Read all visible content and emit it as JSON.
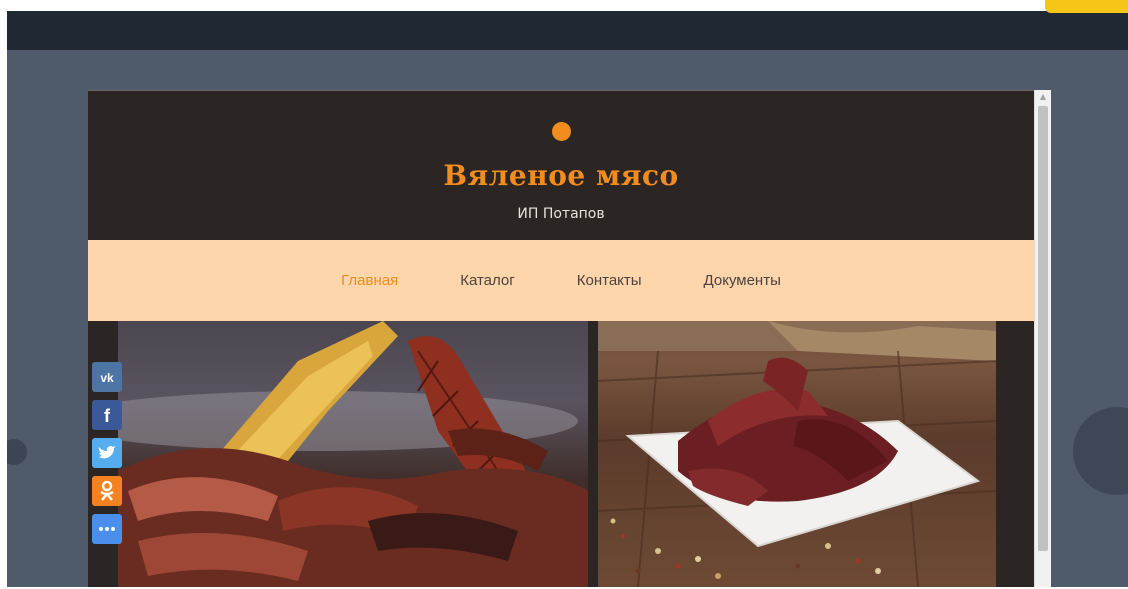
{
  "site": {
    "title": "Вяленое мясо",
    "subtitle": "ИП Потапов"
  },
  "nav": {
    "items": [
      {
        "label": "Главная",
        "active": true
      },
      {
        "label": "Каталог",
        "active": false
      },
      {
        "label": "Контакты",
        "active": false
      },
      {
        "label": "Документы",
        "active": false
      }
    ]
  },
  "social": {
    "buttons": [
      {
        "name": "vk-icon",
        "glyph": "vk",
        "color": "#4c75a3"
      },
      {
        "name": "facebook-icon",
        "glyph": "f",
        "color": "#3b5998"
      },
      {
        "name": "twitter-icon",
        "glyph": "t",
        "color": "#55acee"
      },
      {
        "name": "odnoklassniki-icon",
        "glyph": "ok",
        "color": "#f58220"
      },
      {
        "name": "more-share-icon",
        "glyph": "···",
        "color": "#4b8fec"
      }
    ]
  },
  "colors": {
    "accent": "#f28c1e",
    "header_bg": "#2b2623",
    "nav_bg": "#ffd6ab",
    "page_bg": "#4f5b6a"
  }
}
